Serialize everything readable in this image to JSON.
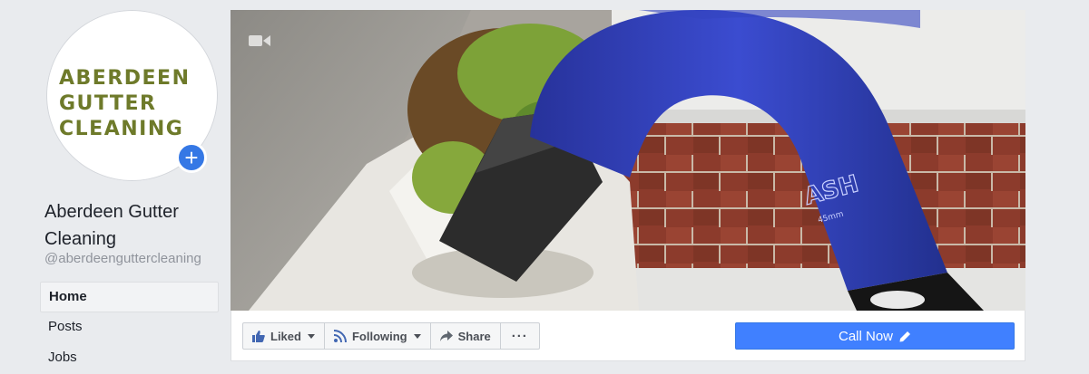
{
  "page": {
    "logo_lines": [
      "ABERDEEN",
      "GUTTER",
      "CLEANING"
    ],
    "name": "Aberdeen Gutter Cleaning",
    "username": "@aberdeenguttercleaning"
  },
  "nav": {
    "items": [
      {
        "label": "Home",
        "active": true
      },
      {
        "label": "Posts",
        "active": false
      },
      {
        "label": "Jobs",
        "active": false
      }
    ]
  },
  "actions": {
    "liked": "Liked",
    "following": "Following",
    "share": "Share",
    "more": "···",
    "call": "Call Now"
  },
  "cover": {
    "hose_text": "ASH",
    "hose_size": "45mm"
  },
  "colors": {
    "primary_button": "#4080ff",
    "logo_green": "#6e7a2a",
    "logo_accent": "#d26a1f",
    "hose_blue": "#2f3fb5"
  },
  "icons": [
    "plus-icon",
    "video-camera-icon",
    "thumbs-up-icon",
    "rss-icon",
    "share-arrow-icon",
    "more-dots-icon",
    "pencil-icon"
  ]
}
